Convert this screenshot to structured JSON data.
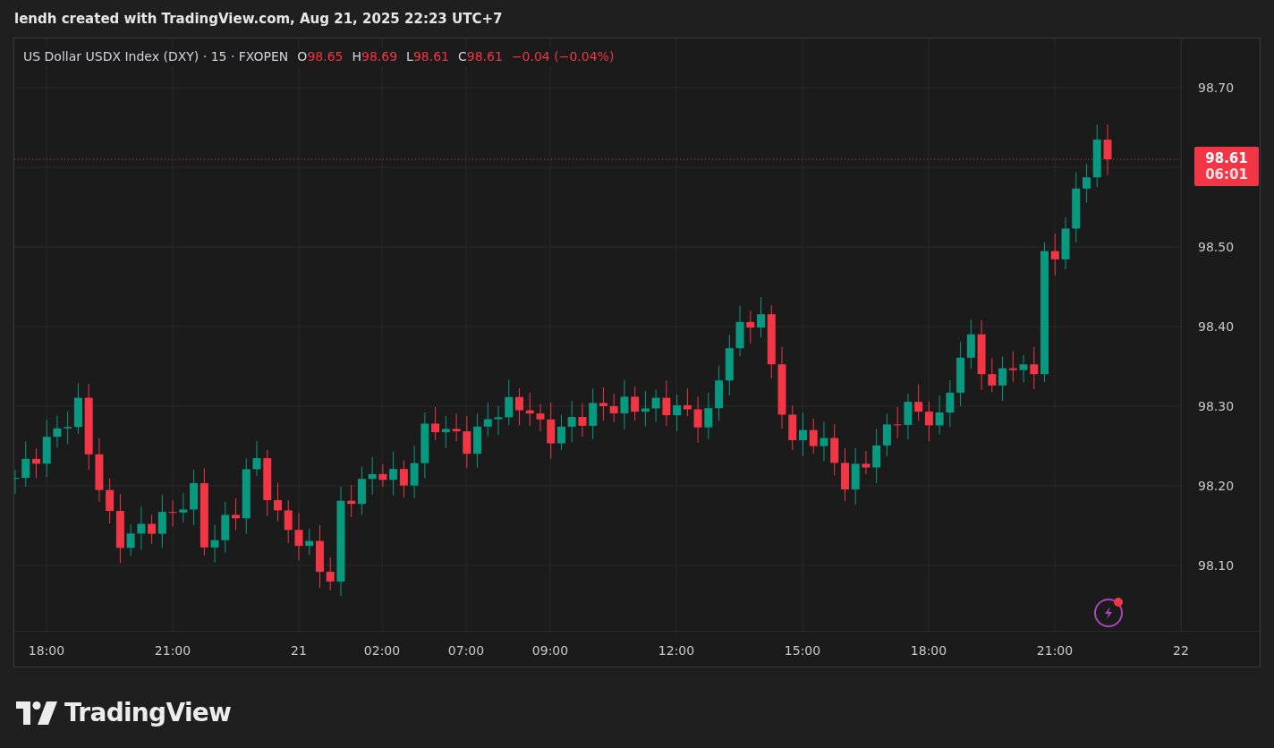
{
  "header": {
    "text": "lendh created with TradingView.com, Aug 21, 2025 22:23 UTC+7"
  },
  "legend": {
    "symbol": "US Dollar USDX Index (DXY) · 15 · FXOPEN",
    "ohlc": [
      {
        "label": "O",
        "value": "98.65"
      },
      {
        "label": "H",
        "value": "98.69"
      },
      {
        "label": "L",
        "value": "98.61"
      },
      {
        "label": "C",
        "value": "98.61"
      }
    ],
    "change": "−0.04 (−0.04%)"
  },
  "price_axis": {
    "labels": [
      "98.70",
      "98.50",
      "98.40",
      "98.30",
      "98.20",
      "98.10"
    ]
  },
  "price_tag": {
    "price": "98.61",
    "countdown": "06:01"
  },
  "time_axis": {
    "labels": [
      "18:00",
      "21:00",
      "21",
      "02:00",
      "07:00",
      "09:00",
      "12:00",
      "15:00",
      "18:00",
      "21:00",
      "22"
    ]
  },
  "logo": {
    "text": "TradingView"
  }
}
